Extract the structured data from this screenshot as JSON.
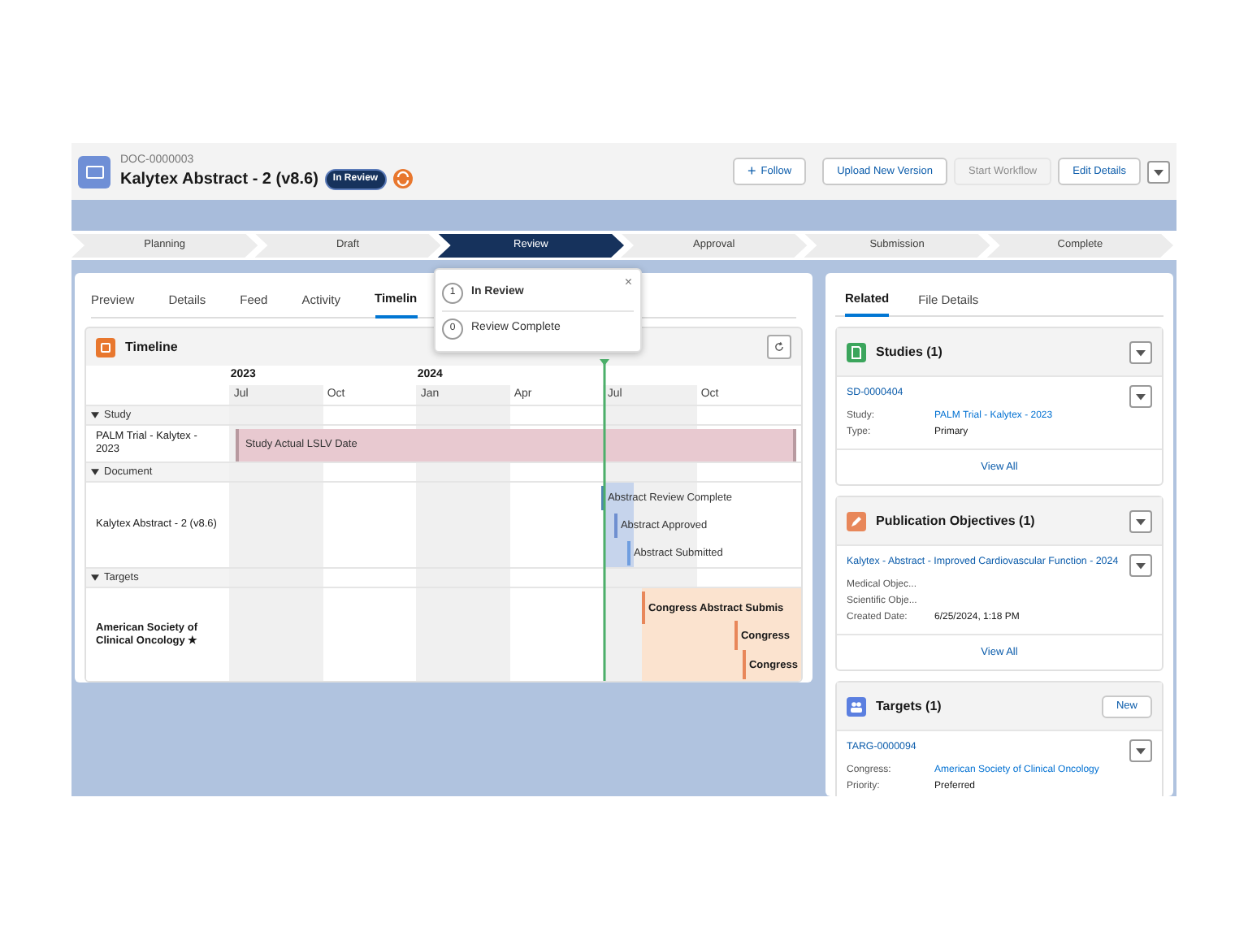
{
  "header": {
    "record_id": "DOC-0000003",
    "title": "Kalytex Abstract - 2 (v8.6)",
    "status_badge": "In Review",
    "buttons": [
      {
        "label": "Follow",
        "kind": "follow",
        "icon": "+",
        "disabled": false
      },
      {
        "label": "Upload New Version",
        "kind": "plain",
        "disabled": false
      },
      {
        "label": "Start Workflow",
        "kind": "plain",
        "disabled": true
      },
      {
        "label": "Edit Details",
        "kind": "plain",
        "disabled": false
      }
    ]
  },
  "path": [
    {
      "label": "Planning",
      "selected": false
    },
    {
      "label": "Draft",
      "selected": false
    },
    {
      "label": "Review",
      "selected": true
    },
    {
      "label": "Approval",
      "selected": false
    },
    {
      "label": "Submission",
      "selected": false
    },
    {
      "label": "Complete",
      "selected": false
    }
  ],
  "tabs": [
    {
      "label": "Preview",
      "selected": false
    },
    {
      "label": "Details",
      "selected": false
    },
    {
      "label": "Feed",
      "selected": false
    },
    {
      "label": "Activity",
      "selected": false
    },
    {
      "label": "Timelin",
      "selected": true
    }
  ],
  "popover": {
    "close": "×",
    "steps": [
      {
        "count": "1",
        "label": "In Review",
        "current": true
      },
      {
        "count": "0",
        "label": "Review Complete",
        "current": false
      }
    ]
  },
  "timeline": {
    "title": "Timeline",
    "years": [
      "2023",
      "2024"
    ],
    "months": [
      "Jul",
      "Oct",
      "Jan",
      "Apr",
      "Jul",
      "Oct"
    ],
    "groups": [
      {
        "label": "Study",
        "expanded": true,
        "rows": [
          {
            "label": "PALM Trial - Kalytex - 2023",
            "bold": false,
            "events": [
              {
                "kind": "span",
                "label": "Study Actual LSLV Date",
                "color": "#e8c9d0"
              }
            ]
          }
        ]
      },
      {
        "label": "Document",
        "expanded": true,
        "rows": [
          {
            "label": "Kalytex Abstract - 2 (v8.6)",
            "bold": false,
            "events": [
              {
                "kind": "milestone",
                "label": "Abstract Review Complete",
                "color": "#4f86b0"
              },
              {
                "kind": "milestone",
                "label": "Abstract Approved",
                "color": "#6f8fd0"
              },
              {
                "kind": "milestone",
                "label": "Abstract Submitted",
                "color": "#6f9ee0"
              }
            ]
          }
        ]
      },
      {
        "label": "Targets",
        "expanded": true,
        "rows": [
          {
            "label": "American Society of Clinical Oncology ★",
            "bold": true,
            "events": [
              {
                "kind": "milestone",
                "label": "Congress Abstract Submis",
                "color": "#e8875a"
              },
              {
                "kind": "milestone",
                "label": "Congress",
                "color": "#e8875a"
              },
              {
                "kind": "milestone",
                "label": "Congress",
                "color": "#e8875a"
              }
            ]
          }
        ]
      }
    ]
  },
  "related": {
    "tabs": [
      {
        "label": "Related",
        "selected": true
      },
      {
        "label": "File Details",
        "selected": false
      }
    ],
    "cards": [
      {
        "kind": "studies",
        "title": "Studies (1)",
        "color": "#3ba55c",
        "record": {
          "id": "SD-0000404",
          "fields": [
            {
              "label": "Study:",
              "value": "PALM Trial - Kalytex - 2023",
              "link": true
            },
            {
              "label": "Type:",
              "value": "Primary",
              "link": false
            }
          ]
        },
        "footer": "View All"
      },
      {
        "kind": "objectives",
        "title": "Publication Objectives (1)",
        "color": "#e8875a",
        "record": {
          "id": "Kalytex - Abstract - Improved Cardiovascular Function - 2024",
          "fields": [
            {
              "label": "Medical Objec..."
            },
            {
              "label": "Scientific Obje..."
            },
            {
              "label": "Created Date:",
              "value": "6/25/2024, 1:18 PM",
              "link": false
            }
          ]
        },
        "footer": "View All"
      },
      {
        "kind": "targets",
        "title": "Targets (1)",
        "color": "#5b7fe0",
        "action": "New",
        "record": {
          "id": "TARG-0000094",
          "fields": [
            {
              "label": "Congress:",
              "value": "American Society of Clinical Oncology",
              "link": true
            },
            {
              "label": "Priority:",
              "value": "Preferred",
              "link": false
            }
          ]
        }
      }
    ]
  }
}
